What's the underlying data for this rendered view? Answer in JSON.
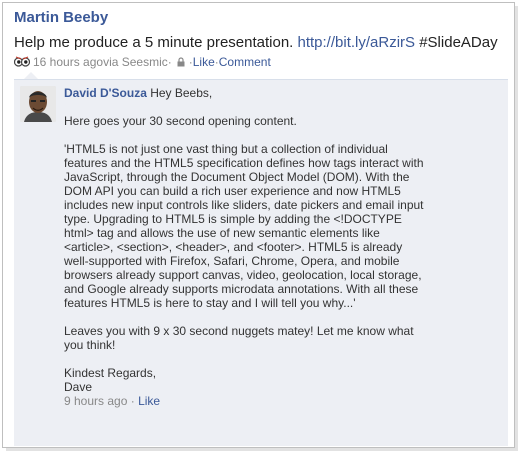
{
  "post": {
    "author": "Martin Beeby",
    "text": "Help me produce a 5 minute presentation. ",
    "link": "http://bit.ly/aRzirS",
    "hashtag": " #SlideADay",
    "time": "16 hours ago",
    "via": " via Seesmic",
    "sep1": " · ",
    "sep2": " · ",
    "sep3": " · ",
    "like": "Like",
    "comment": "Comment"
  },
  "comment": {
    "author": "David D'Souza",
    "greeting": " Hey Beebs,",
    "p1": "Here goes your 30 second opening content.",
    "p2": "'HTML5 is not just one vast thing but a collection of individual\nfeatures and the HTML5 specification defines how tags interact with\nJavaScript, through the Document Object Model (DOM). With the\nDOM API you can build a rich user experience and now HTML5\nincludes new input controls like sliders, date pickers and email input\ntype. Upgrading to HTML5 is simple by adding the <!DOCTYPE\nhtml> tag and allows the use of new semantic elements like\n<article>, <section>, <header>, and <footer>. HTML5 is already\nwell-supported with Firefox, Safari, Chrome, Opera, and mobile\nbrowsers already support canvas, video, geolocation, local storage,\nand Google already supports microdata annotations. With all these\nfeatures HTML5 is here to stay and I will tell you why...'",
    "p3": "Leaves you with 9 x 30 second nuggets matey! Let me know what\nyou think!",
    "p4": "Kindest Regards,\nDave",
    "time": "9 hours ago",
    "sep": " · ",
    "like": "Like"
  },
  "icons": {
    "app": "seesmic-app-icon",
    "privacy": "lock-icon",
    "avatar": "avatar"
  },
  "colors": {
    "link": "#3b5998",
    "meta": "#888888",
    "comment_bg": "#edeff4"
  }
}
